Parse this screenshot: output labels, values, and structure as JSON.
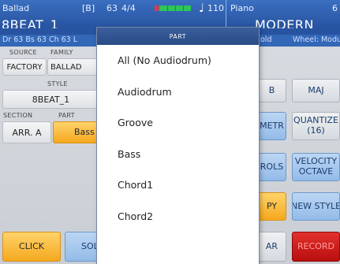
{
  "status_bar": {
    "style_short": "Ballad",
    "variation": "[B]",
    "style_num": "63",
    "time_sig": "4/4",
    "tempo": "110",
    "voice_name": "Piano",
    "right_num": "6",
    "note_icon": "note-icon"
  },
  "title_row": {
    "style_name": "8BEAT_1",
    "voice_style": "MODERN"
  },
  "info_row": {
    "left": "Dr 63  Bs 63  Ch 63 L",
    "mid": "old",
    "right": "Wheel: Modu"
  },
  "left_panel": {
    "source_label": "SOURCE",
    "family_label": "FAMILY",
    "source_value": "FACTORY",
    "family_value": "BALLAD",
    "style_label": "STYLE",
    "style_value": "8BEAT_1",
    "section_label": "SECTION",
    "part_label": "PART",
    "section_value": "ARR. A",
    "part_value": "Bass"
  },
  "right_buttons": {
    "b": "B",
    "maj": "MAJ",
    "metr": "METR",
    "quantize": "QUANTIZE",
    "quantize_sub": "(16)",
    "rols": "ROLS",
    "velocity": "VELOCITY",
    "octave": "OCTAVE",
    "py": "PY",
    "new_style": "NEW STYLE",
    "ar": "AR",
    "record": "RECORD"
  },
  "bottom_buttons": {
    "click": "CLICK",
    "solo": "SOLO"
  },
  "popup": {
    "title": "PART",
    "items": [
      "All (No Audiodrum)",
      "Audiodrum",
      "Groove",
      "Bass",
      "Chord1",
      "Chord2"
    ]
  },
  "colors": {
    "header_blue": "#2f62b2",
    "accent_orange": "#f5a81e",
    "record_red": "#c41b18",
    "button_blue": "#a7c8ee"
  }
}
